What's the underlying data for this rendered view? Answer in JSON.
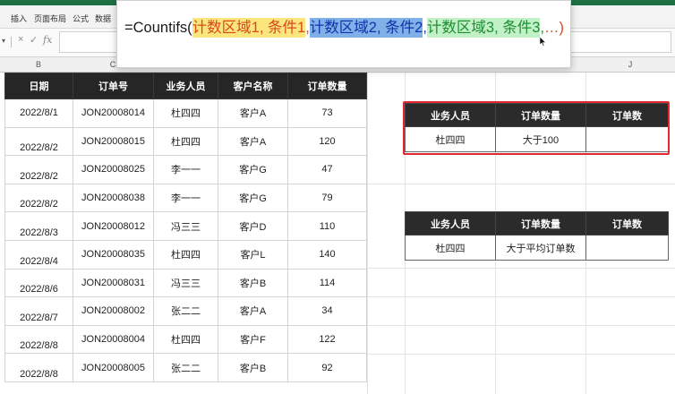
{
  "ribbon_menu": [
    "插入",
    "页面布局",
    "公式",
    "数据"
  ],
  "formula_bar": {
    "cancel_icon": "×",
    "confirm_icon": "✓",
    "fx_label": "fx"
  },
  "columns": [
    "B",
    "C",
    "",
    "",
    "",
    "",
    "",
    "",
    "J"
  ],
  "formula_popup": {
    "prefix": "=Countifs(",
    "range1": "计数区域1,",
    "cond1": " 条件1",
    "sep1": ",",
    "range2": "计数区域2,",
    "cond2": " 条件2",
    "sep2": ",",
    "range3": "计数区域3,",
    "cond3": " 条件3",
    "sep3": ",",
    "suffix": "…)"
  },
  "main_table": {
    "headers": [
      "日期",
      "订单号",
      "业务人员",
      "客户名称",
      "订单数量"
    ],
    "rows": [
      [
        "2022/8/1",
        "JON20008014",
        "杜四四",
        "客户A",
        "73"
      ],
      [
        "2022/8/2",
        "JON20008015",
        "杜四四",
        "客户A",
        "120"
      ],
      [
        "2022/8/2",
        "JON20008025",
        "李一一",
        "客户G",
        "47"
      ],
      [
        "2022/8/2",
        "JON20008038",
        "李一一",
        "客户G",
        "79"
      ],
      [
        "2022/8/3",
        "JON20008012",
        "冯三三",
        "客户D",
        "110"
      ],
      [
        "2022/8/4",
        "JON20008035",
        "杜四四",
        "客户L",
        "140"
      ],
      [
        "2022/8/6",
        "JON20008031",
        "冯三三",
        "客户B",
        "114"
      ],
      [
        "2022/8/7",
        "JON20008002",
        "张二二",
        "客户A",
        "34"
      ],
      [
        "2022/8/8",
        "JON20008004",
        "杜四四",
        "客户F",
        "122"
      ],
      [
        "2022/8/8",
        "JON20008005",
        "张二二",
        "客户B",
        "92"
      ]
    ]
  },
  "side_table_1": {
    "headers": [
      "业务人员",
      "订单数量",
      "订单数"
    ],
    "row": [
      "杜四四",
      "大于100",
      ""
    ]
  },
  "side_table_2": {
    "headers": [
      "业务人员",
      "订单数量",
      "订单数"
    ],
    "row": [
      "杜四四",
      "大于平均订单数",
      ""
    ]
  },
  "colors": {
    "header_bg": "#262626",
    "highlight_border": "#e0282e",
    "excel_green": "#1e7145"
  }
}
